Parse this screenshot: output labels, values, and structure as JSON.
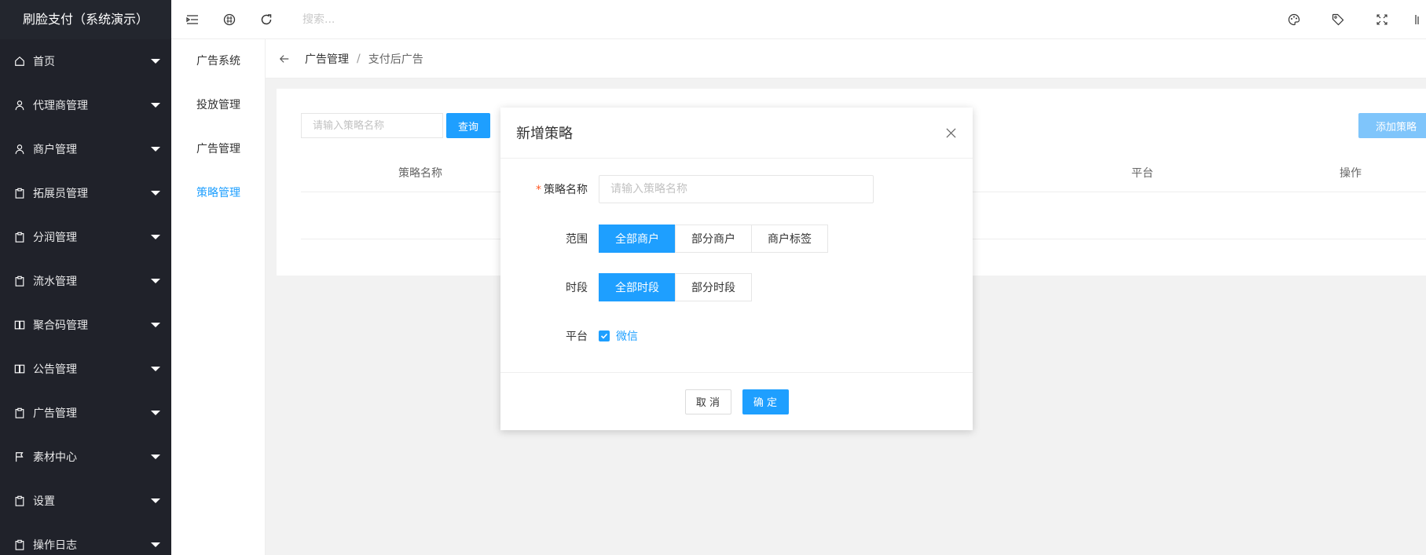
{
  "brand": {
    "title": "刷脸支付（系统演示）"
  },
  "sidebar": {
    "items": [
      {
        "label": "首页",
        "icon": "home-icon"
      },
      {
        "label": "代理商管理",
        "icon": "user-icon"
      },
      {
        "label": "商户管理",
        "icon": "user-icon"
      },
      {
        "label": "拓展员管理",
        "icon": "clipboard-icon"
      },
      {
        "label": "分润管理",
        "icon": "clipboard-icon"
      },
      {
        "label": "流水管理",
        "icon": "clipboard-icon"
      },
      {
        "label": "聚合码管理",
        "icon": "book-icon"
      },
      {
        "label": "公告管理",
        "icon": "book-icon"
      },
      {
        "label": "广告管理",
        "icon": "clipboard-icon"
      },
      {
        "label": "素材中心",
        "icon": "flag-icon"
      },
      {
        "label": "设置",
        "icon": "clipboard-icon"
      },
      {
        "label": "操作日志",
        "icon": "clipboard-icon"
      }
    ]
  },
  "header": {
    "search_placeholder": "搜索..."
  },
  "submenu": {
    "items": [
      {
        "label": "广告系统",
        "active": false
      },
      {
        "label": "投放管理",
        "active": false
      },
      {
        "label": "广告管理",
        "active": false
      },
      {
        "label": "策略管理",
        "active": true
      }
    ]
  },
  "breadcrumb": {
    "parent": "广告管理",
    "separator": "/",
    "current": "支付后广告"
  },
  "card": {
    "query_placeholder": "请输入策略名称",
    "query_button": "查询",
    "add_button": "添加策略",
    "columns": [
      "策略名称",
      "平台",
      "操作"
    ]
  },
  "modal": {
    "title": "新增策略",
    "name_label": "策略名称",
    "required_mark": "*",
    "name_placeholder": "请输入策略名称",
    "scope_label": "范围",
    "scope_options": [
      "全部商户",
      "部分商户",
      "商户标签"
    ],
    "period_label": "时段",
    "period_options": [
      "全部时段",
      "部分时段"
    ],
    "platform_label": "平台",
    "platform_option": "微信",
    "cancel_button": "取 消",
    "confirm_button": "确 定"
  },
  "colors": {
    "primary": "#1e9fff",
    "sidebar_bg": "#20222a",
    "required": "#ff5722"
  }
}
